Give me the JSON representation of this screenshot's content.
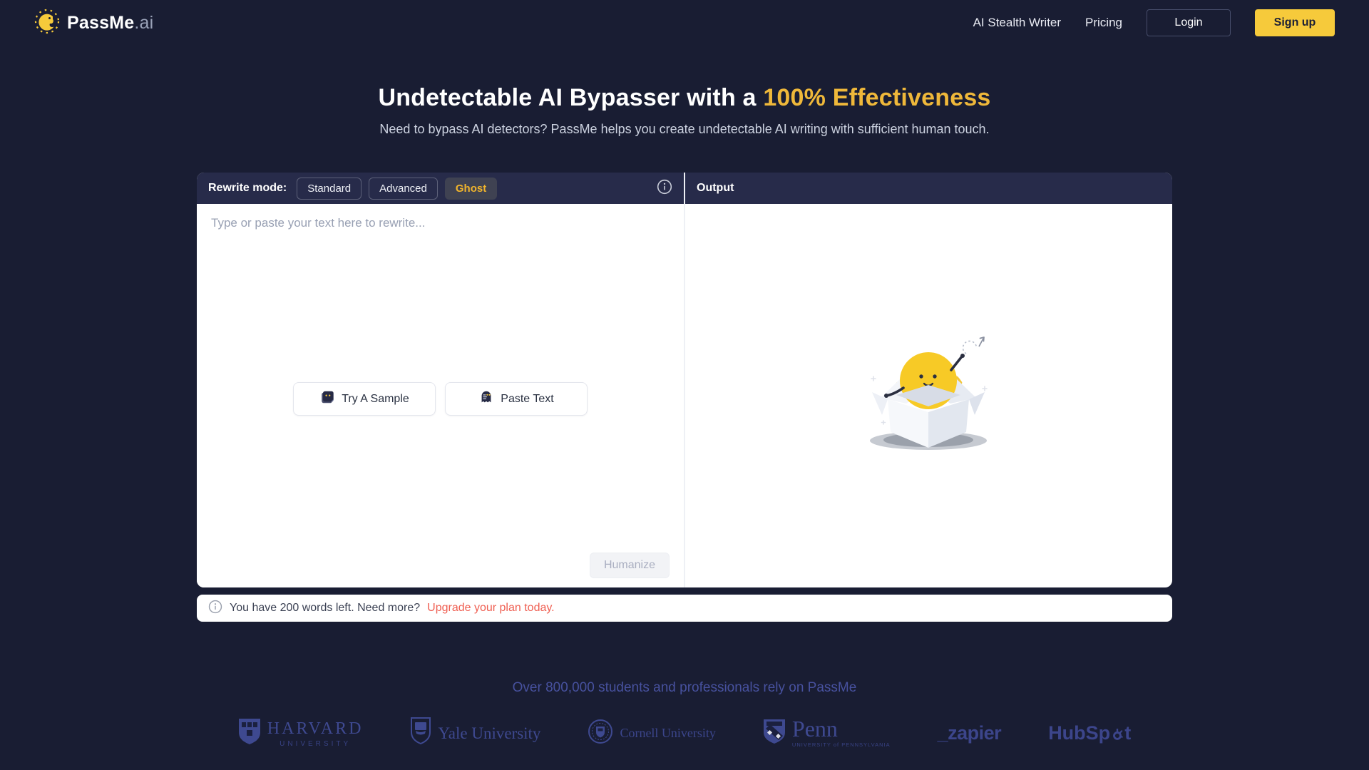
{
  "colors": {
    "page_bg": "#191d33",
    "panel_header_bg": "#272b4a",
    "accent_yellow": "#f6ca3b",
    "heading_yellow": "#efb83a",
    "ghost_active_text": "#f0b42c",
    "link_red": "#ef5e51",
    "footer_indigo": "#47519e"
  },
  "brand": {
    "name": "PassMe",
    "suffix": ".ai"
  },
  "nav": {
    "links": [
      {
        "label": "AI Stealth Writer"
      },
      {
        "label": "Pricing"
      }
    ],
    "login": "Login",
    "signup": "Sign up"
  },
  "hero": {
    "title_prefix": "Undetectable AI Bypasser with a ",
    "title_highlight": "100% Effectiveness",
    "subtitle": "Need to bypass AI detectors? PassMe helps you create undetectable AI writing with sufficient human touch."
  },
  "editor": {
    "mode_label": "Rewrite mode:",
    "modes": [
      {
        "label": "Standard",
        "active": false
      },
      {
        "label": "Advanced",
        "active": false
      },
      {
        "label": "Ghost",
        "active": true
      }
    ],
    "output_title": "Output",
    "placeholder": "Type or paste your text here to rewrite...",
    "try_sample": "Try A Sample",
    "paste_text": "Paste Text",
    "humanize": "Humanize"
  },
  "banner": {
    "message": "You have 200 words left. Need more?",
    "link": "Upgrade your plan today."
  },
  "footer": {
    "tagline": "Over 800,000 students and professionals rely on PassMe",
    "logos": {
      "harvard": {
        "line1": "HARVARD",
        "line2": "UNIVERSITY"
      },
      "yale": {
        "text": "Yale University"
      },
      "cornell": {
        "text": "Cornell University"
      },
      "penn": {
        "text": "Penn",
        "sub": "UNIVERSITY of PENNSYLVANIA"
      },
      "zapier": {
        "text": "_zapier"
      },
      "hubspot": {
        "pre": "HubSp",
        "post": "t"
      }
    }
  }
}
